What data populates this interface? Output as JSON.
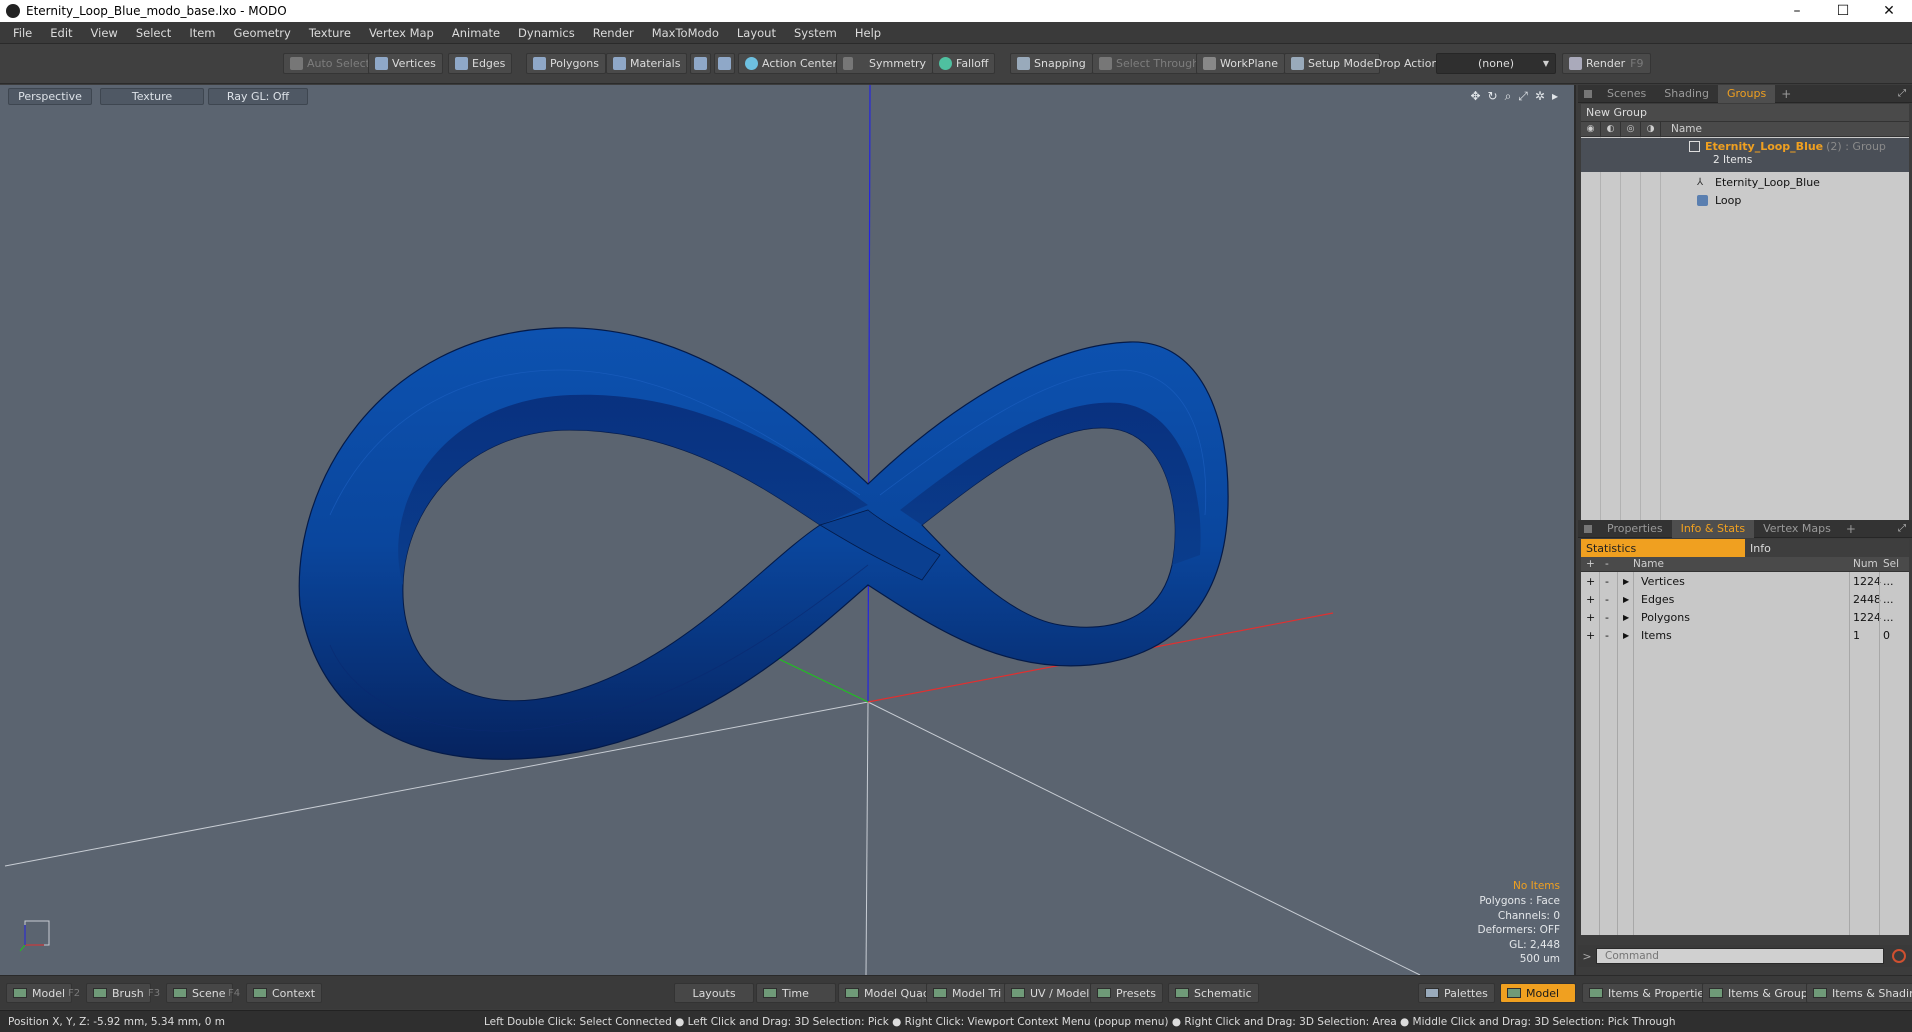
{
  "window": {
    "title": "Eternity_Loop_Blue_modo_base.lxo - MODO",
    "minimize": "–",
    "maximize": "☐",
    "close": "✕"
  },
  "menu": [
    "File",
    "Edit",
    "View",
    "Select",
    "Item",
    "Geometry",
    "Texture",
    "Vertex Map",
    "Animate",
    "Dynamics",
    "Render",
    "MaxToModo",
    "Layout",
    "System",
    "Help"
  ],
  "toolbar": {
    "auto_select": "Auto Select",
    "vertices": "Vertices",
    "edges": "Edges",
    "polygons": "Polygons",
    "materials": "Materials",
    "action_center": "Action Center",
    "symmetry": "Symmetry",
    "falloff": "Falloff",
    "snapping": "Snapping",
    "select_through": "Select Through",
    "workplane": "WorkPlane",
    "setup_mode": "Setup Mode",
    "drop_action_label": "Drop Action",
    "drop_action_value": "(none)",
    "render": "Render",
    "render_key": "F9"
  },
  "viewport": {
    "tabs": [
      "Perspective",
      "Texture",
      "Ray GL: Off"
    ],
    "info": {
      "no_items": "No Items",
      "polygons": "Polygons : Face",
      "channels": "Channels: 0",
      "deformers": "Deformers: OFF",
      "gl": "GL: 2,448",
      "scale": "500 um"
    },
    "colors": {
      "background": "#5b6470",
      "mesh": "#0b46a0",
      "axis_x": "#e03030",
      "axis_y": "#2020ff",
      "axis_z": "#20c020"
    }
  },
  "groups_panel": {
    "tabs": [
      "Scenes",
      "Shading",
      "Groups"
    ],
    "active_tab": "Groups",
    "new_group": "New Group",
    "name_header": "Name",
    "group": {
      "name": "Eternity_Loop_Blue",
      "sub": "(2) : Group",
      "count": "2 Items",
      "children": [
        "Eternity_Loop_Blue",
        "Loop"
      ]
    }
  },
  "stats_panel": {
    "tabs": [
      "Properties",
      "Info & Stats",
      "Vertex Maps"
    ],
    "active_tab": "Info & Stats",
    "subtabs": [
      "Statistics",
      "Info"
    ],
    "headers": {
      "name": "Name",
      "num": "Num",
      "sel": "Sel"
    },
    "rows": [
      {
        "name": "Vertices",
        "num": "1224",
        "sel": "..."
      },
      {
        "name": "Edges",
        "num": "2448",
        "sel": "..."
      },
      {
        "name": "Polygons",
        "num": "1224",
        "sel": "..."
      },
      {
        "name": "Items",
        "num": "1",
        "sel": "0"
      }
    ]
  },
  "command": {
    "prompt": ">",
    "placeholder": "Command"
  },
  "bottombar": {
    "model": "Model",
    "model_key": "F2",
    "brush": "Brush",
    "brush_key": "F3",
    "scene": "Scene",
    "scene_key": "F4",
    "context": "Context",
    "layouts": "Layouts",
    "time": "Time",
    "model_quad": "Model Quad",
    "model_tri": "Model Tri",
    "uv_model": "UV / Model",
    "presets": "Presets",
    "schematic": "Schematic",
    "palettes": "Palettes",
    "model_active": "Model",
    "items_properties": "Items & Properties",
    "items_groups": "Items & Groups",
    "items_shading": "Items & Shading"
  },
  "status": {
    "position": "Position X, Y, Z:   -5.92 mm, 5.34 mm, 0 m",
    "hints": "Left Double Click: Select Connected ● Left Click and Drag: 3D Selection: Pick ● Right Click: Viewport Context Menu (popup menu) ● Right Click and Drag: 3D Selection: Area ● Middle Click and Drag: 3D Selection: Pick Through"
  }
}
